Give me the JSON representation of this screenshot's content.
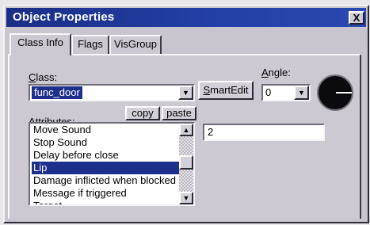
{
  "window": {
    "title": "Object Properties",
    "close_glyph": "X"
  },
  "tabs": [
    {
      "label": "Class Info",
      "active": true
    },
    {
      "label": "Flags",
      "active": false
    },
    {
      "label": "VisGroup",
      "active": false
    }
  ],
  "class_field": {
    "label_prefix": "C",
    "label_rest": "lass:",
    "value": "func_door"
  },
  "smartedit_button": {
    "prefix": "S",
    "rest": "martEdit"
  },
  "angle": {
    "label_prefix": "A",
    "label_rest": "ngle:",
    "value": "0"
  },
  "attributes": {
    "label": "Attributes:",
    "items": [
      "Move Sound",
      "Stop Sound",
      "Delay before close",
      "Lip",
      "Damage inflicted when blocked",
      "Message if triggered",
      "Target"
    ],
    "selected_index": 3
  },
  "copy_button": "copy",
  "paste_button": "paste",
  "value_field": {
    "value": "2"
  },
  "icons": {
    "dropdown": "chevron-down-icon",
    "scroll_up": "arrow-up-icon",
    "scroll_down": "arrow-down-icon"
  }
}
